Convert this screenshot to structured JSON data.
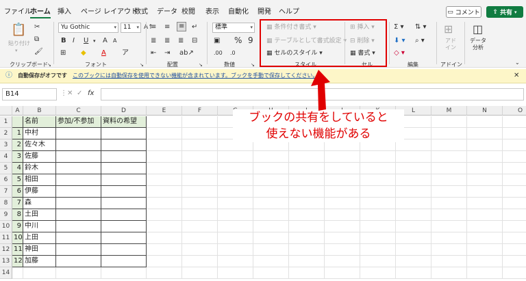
{
  "menu": {
    "tabs": [
      "ファイル",
      "ホーム",
      "挿入",
      "ページ レイアウト",
      "数式",
      "データ",
      "校閲",
      "表示",
      "自動化",
      "開発",
      "ヘルプ"
    ],
    "comment": "コメント",
    "share": "共有"
  },
  "ribbon": {
    "clipboard": {
      "paste": "貼り付け",
      "label": "クリップボード"
    },
    "font": {
      "name": "Yu Gothic",
      "size": "11",
      "label": "フォント",
      "bold": "B",
      "italic": "I",
      "underline": "U"
    },
    "align": {
      "label": "配置"
    },
    "number": {
      "format": "標準",
      "label": "数値"
    },
    "styles": {
      "cond": "条件付き書式",
      "table": "テーブルとして書式設定",
      "cell": "セルのスタイル",
      "label": "スタイル"
    },
    "cells": {
      "insert": "挿入",
      "delete": "削除",
      "format": "書式",
      "label": "セル"
    },
    "edit": {
      "label": "編集"
    },
    "addin": {
      "addin": "アド\nイン",
      "label": "アドイン"
    },
    "analysis": {
      "text": "データ\n分析"
    }
  },
  "message": {
    "title": "自動保存がオフです",
    "text": "このブックには自動保存を使用できない機能が含まれています。ブックを手動で保存してください。"
  },
  "formula_bar": {
    "name_box": "B14",
    "fx": "fx"
  },
  "sheet": {
    "columns": [
      "A",
      "B",
      "C",
      "D",
      "E",
      "F",
      "G",
      "H",
      "I",
      "J",
      "K",
      "L",
      "M",
      "N",
      "O"
    ],
    "rows": [
      "1",
      "2",
      "3",
      "4",
      "5",
      "6",
      "7",
      "8",
      "9",
      "10",
      "11",
      "12",
      "13",
      "14"
    ],
    "headers": [
      "名前",
      "参加/不参加",
      "資料の希望"
    ],
    "data": [
      [
        "1",
        "中村"
      ],
      [
        "2",
        "佐々木"
      ],
      [
        "3",
        "佐藤"
      ],
      [
        "4",
        "鈴木"
      ],
      [
        "5",
        "相田"
      ],
      [
        "6",
        "伊藤"
      ],
      [
        "7",
        "森"
      ],
      [
        "8",
        "土田"
      ],
      [
        "9",
        "中川"
      ],
      [
        "10",
        "上田"
      ],
      [
        "11",
        "神田"
      ],
      [
        "12",
        "加藤"
      ]
    ]
  },
  "annotation": {
    "line1": "ブックの共有をしていると",
    "line2": "使えない機能がある"
  },
  "colors": {
    "accent": "#107c41",
    "highlight": "#e00000",
    "msg_bg": "#fdf6c8"
  }
}
